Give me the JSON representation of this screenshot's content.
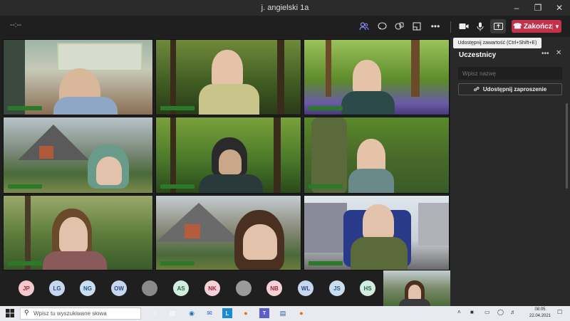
{
  "window": {
    "title": "j. angielski 1a"
  },
  "meeting": {
    "timer": "--:--",
    "end_label": "Zakończ",
    "share_tooltip": "Udostępnij zawartość (Ctrl+Shift+E)"
  },
  "participants_panel": {
    "title": "Uczestnicy",
    "search_placeholder": "Wpisz nazwę",
    "invite_label": "Udostępnij zaproszenie"
  },
  "avatars": [
    {
      "initials": "JP",
      "bg": "#f3c9cf",
      "fg": "#9a2a3a"
    },
    {
      "initials": "LG",
      "bg": "#c7d7ef",
      "fg": "#2c4d84"
    },
    {
      "initials": "NG",
      "bg": "#c9dff0",
      "fg": "#2a5a80"
    },
    {
      "initials": "OW",
      "bg": "#c7d7ef",
      "fg": "#2c4d84"
    },
    {
      "initials": "",
      "bg": "#8a8a8a",
      "fg": "#333"
    },
    {
      "initials": "AS",
      "bg": "#d2ecdf",
      "fg": "#2a6a4a"
    },
    {
      "initials": "NK",
      "bg": "#f4d2d8",
      "fg": "#9a2a3a"
    },
    {
      "initials": "",
      "bg": "#9a9a9a",
      "fg": "#333"
    },
    {
      "initials": "NB",
      "bg": "#f4d2d8",
      "fg": "#9a2a3a"
    },
    {
      "initials": "WL",
      "bg": "#c7d7ef",
      "fg": "#2c4d84"
    },
    {
      "initials": "JS",
      "bg": "#c9dff0",
      "fg": "#2a5a80"
    },
    {
      "initials": "HS",
      "bg": "#d2ecdf",
      "fg": "#2a6a4a"
    }
  ],
  "taskbar": {
    "search_placeholder": "Wpisz tu wyszukiwane słowa",
    "time": "08:05",
    "date": "22.04.2021"
  },
  "colors": {
    "accent": "#8b8cf8",
    "end_red": "#c4314b",
    "name_tag": "#2a7a2a"
  }
}
